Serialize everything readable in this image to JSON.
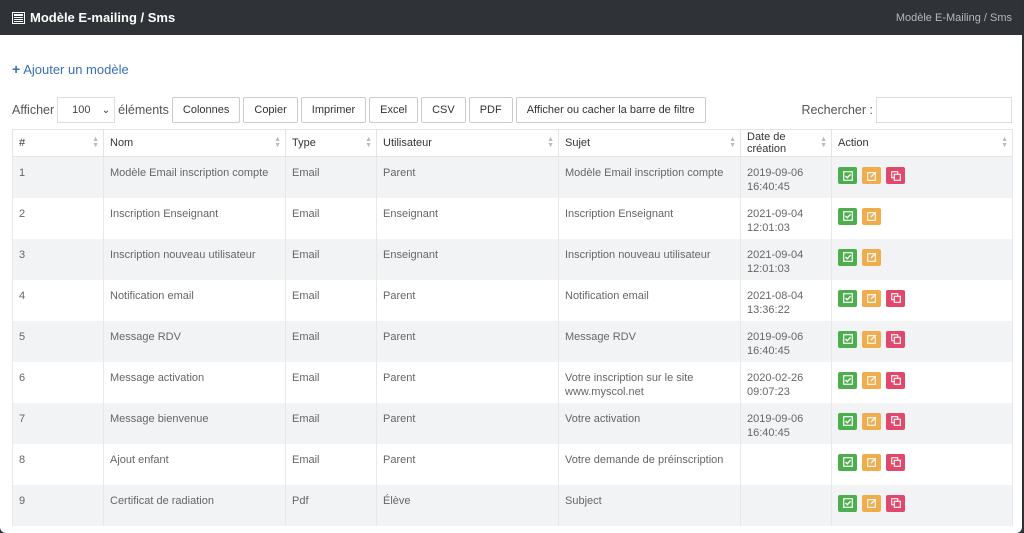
{
  "header": {
    "title": "Modèle E-mailing / Sms",
    "breadcrumb": "Modèle E-Mailing / Sms"
  },
  "add_label": "Ajouter un modèle",
  "controls": {
    "show_label": "Afficher",
    "page_size": "100",
    "elements_label": "éléments",
    "buttons": [
      "Colonnes",
      "Copier",
      "Imprimer",
      "Excel",
      "CSV",
      "PDF",
      "Afficher ou cacher la barre de filtre"
    ],
    "search_label": "Rechercher :",
    "search_value": ""
  },
  "table": {
    "columns": [
      "#",
      "Nom",
      "Type",
      "Utilisateur",
      "Sujet",
      "Date de création",
      "Action"
    ],
    "rows": [
      {
        "num": "1",
        "nom": "Modèle Email inscription compte",
        "type": "Email",
        "utilisateur": "Parent",
        "sujet": "Modèle Email inscription compte",
        "date": "2019-09-06",
        "time": "16:40:45",
        "delete": true
      },
      {
        "num": "2",
        "nom": "Inscription Enseignant",
        "type": "Email",
        "utilisateur": "Enseignant",
        "sujet": "Inscription Enseignant",
        "date": "2021-09-04",
        "time": "12:01:03",
        "delete": false
      },
      {
        "num": "3",
        "nom": "Inscription nouveau utilisateur",
        "type": "Email",
        "utilisateur": "Enseignant",
        "sujet": "Inscription nouveau utilisateur",
        "date": "2021-09-04",
        "time": "12:01:03",
        "delete": false
      },
      {
        "num": "4",
        "nom": "Notification email",
        "type": "Email",
        "utilisateur": "Parent",
        "sujet": "Notification email",
        "date": "2021-08-04",
        "time": "13:36:22",
        "delete": true
      },
      {
        "num": "5",
        "nom": "Message RDV",
        "type": "Email",
        "utilisateur": "Parent",
        "sujet": "Message RDV",
        "date": "2019-09-06",
        "time": "16:40:45",
        "delete": true
      },
      {
        "num": "6",
        "nom": "Message activation",
        "type": "Email",
        "utilisateur": "Parent",
        "sujet": "Votre inscription sur le site",
        "sujet2": "www.myscol.net",
        "date": "2020-02-26",
        "time": "09:07:23",
        "delete": true
      },
      {
        "num": "7",
        "nom": "Message bienvenue",
        "type": "Email",
        "utilisateur": "Parent",
        "sujet": "Votre activation",
        "date": "2019-09-06",
        "time": "16:40:45",
        "delete": true
      },
      {
        "num": "8",
        "nom": "Ajout enfant",
        "type": "Email",
        "utilisateur": "Parent",
        "sujet": "Votre demande de préinscription",
        "date": "",
        "time": "",
        "delete": true
      },
      {
        "num": "9",
        "nom": "Certificat de radiation",
        "type": "Pdf",
        "utilisateur": "Élève",
        "sujet": "Subject",
        "date": "",
        "time": "",
        "delete": true
      }
    ]
  },
  "colors": {
    "topbar": "#2f3237",
    "link": "#3a6fb5",
    "view": "#4cae4c",
    "edit": "#f0ad4e",
    "delete": "#e0496b"
  },
  "icons": {
    "title": "newspaper-icon",
    "add": "plus-icon",
    "view": "check-square-icon",
    "edit": "edit-icon",
    "delete": "copy-icon"
  }
}
